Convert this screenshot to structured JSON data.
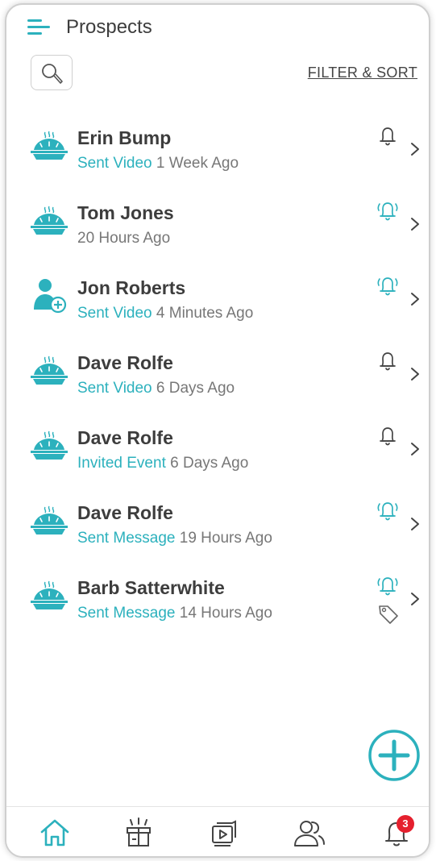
{
  "header": {
    "title": "Prospects",
    "filter_label": "FILTER & SORT"
  },
  "colors": {
    "accent": "#2cb1bd",
    "badge": "#e5202e",
    "text": "#3d3d3d",
    "muted": "#777777"
  },
  "prospects": [
    {
      "name": "Erin Bump",
      "action": "Sent Video",
      "time": "1 Week Ago",
      "icon": "pie-icon",
      "bell": "bell-icon",
      "tag": false
    },
    {
      "name": "Tom Jones",
      "action": "",
      "time": "20 Hours Ago",
      "icon": "pie-icon",
      "bell": "bell-ringing-icon",
      "tag": false
    },
    {
      "name": "Jon Roberts",
      "action": "Sent Video",
      "time": "4 Minutes Ago",
      "icon": "add-user-icon",
      "bell": "bell-ringing-icon",
      "tag": false
    },
    {
      "name": "Dave Rolfe",
      "action": "Sent Video",
      "time": "6 Days Ago",
      "icon": "pie-icon",
      "bell": "bell-icon",
      "tag": false
    },
    {
      "name": "Dave Rolfe",
      "action": "Invited Event",
      "time": "6 Days Ago",
      "icon": "pie-icon",
      "bell": "bell-icon",
      "tag": false
    },
    {
      "name": "Dave Rolfe",
      "action": "Sent Message",
      "time": "19 Hours Ago",
      "icon": "pie-icon",
      "bell": "bell-ringing-icon",
      "tag": false
    },
    {
      "name": "Barb Satterwhite",
      "action": "Sent Message",
      "time": "14 Hours Ago",
      "icon": "pie-icon",
      "bell": "bell-ringing-icon",
      "tag": true
    }
  ],
  "nav": {
    "items": [
      {
        "icon": "home-icon",
        "active": true
      },
      {
        "icon": "gift-icon",
        "active": false
      },
      {
        "icon": "media-icon",
        "active": false
      },
      {
        "icon": "contacts-icon",
        "active": false
      },
      {
        "icon": "notifications-icon",
        "active": false
      }
    ],
    "notification_count": "3"
  }
}
